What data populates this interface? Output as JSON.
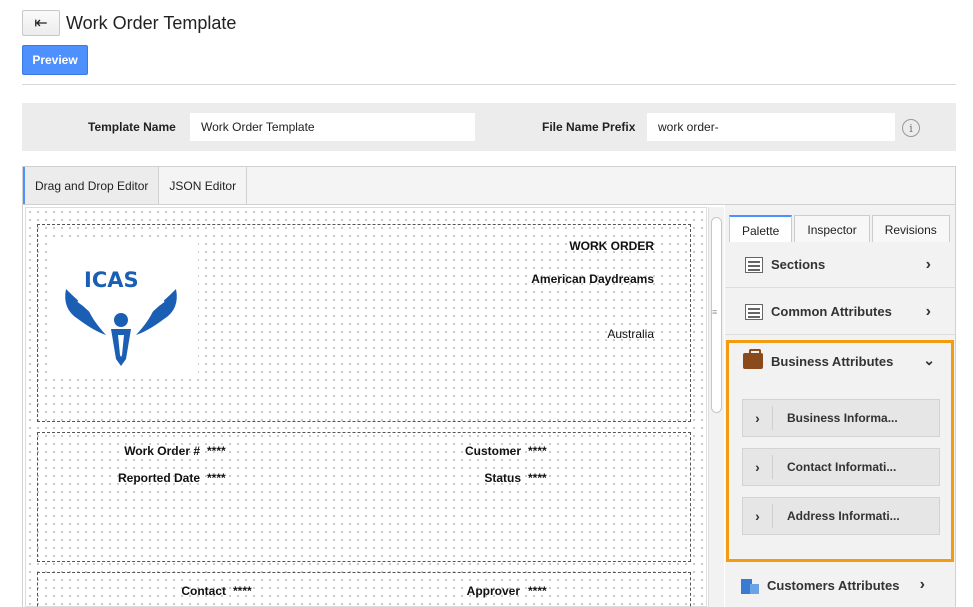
{
  "header": {
    "back_icon": "back-arrow-icon",
    "title": "Work Order Template",
    "preview_label": "Preview"
  },
  "template_bar": {
    "template_name_label": "Template Name",
    "template_name_value": "Work Order Template",
    "file_prefix_label": "File Name Prefix",
    "file_prefix_value": "work order-",
    "info_icon": "info-icon"
  },
  "editor_tabs": [
    "Drag and Drop Editor",
    "JSON Editor"
  ],
  "canvas": {
    "header_section": {
      "logo_text": "ICAS",
      "title": "WORK ORDER",
      "company": "American Daydreams",
      "country": "Australia"
    },
    "details_section": {
      "fields": [
        {
          "label": "Work Order #",
          "value": "****"
        },
        {
          "label": "Customer",
          "value": "****"
        },
        {
          "label": "Reported Date",
          "value": "****"
        },
        {
          "label": "Status",
          "value": "****"
        }
      ]
    },
    "contact_section": {
      "fields": [
        {
          "label": "Contact",
          "value": "****"
        },
        {
          "label": "Approver",
          "value": "****"
        }
      ]
    }
  },
  "right_panel": {
    "tabs": [
      "Palette",
      "Inspector",
      "Revisions"
    ],
    "items": [
      {
        "label": "Sections",
        "icon": "layout-icon"
      },
      {
        "label": "Common Attributes",
        "icon": "layout-icon"
      }
    ],
    "business": {
      "label": "Business Attributes",
      "icon": "briefcase-icon",
      "subitems": [
        "Business Informa...",
        "Contact Informati...",
        "Address Informati..."
      ]
    },
    "customers": {
      "label": "Customers Attributes",
      "icon": "building-icon"
    }
  },
  "colors": {
    "accent": "#4d90fe",
    "highlight": "#f39c12",
    "logo_blue": "#1a5fb4"
  }
}
